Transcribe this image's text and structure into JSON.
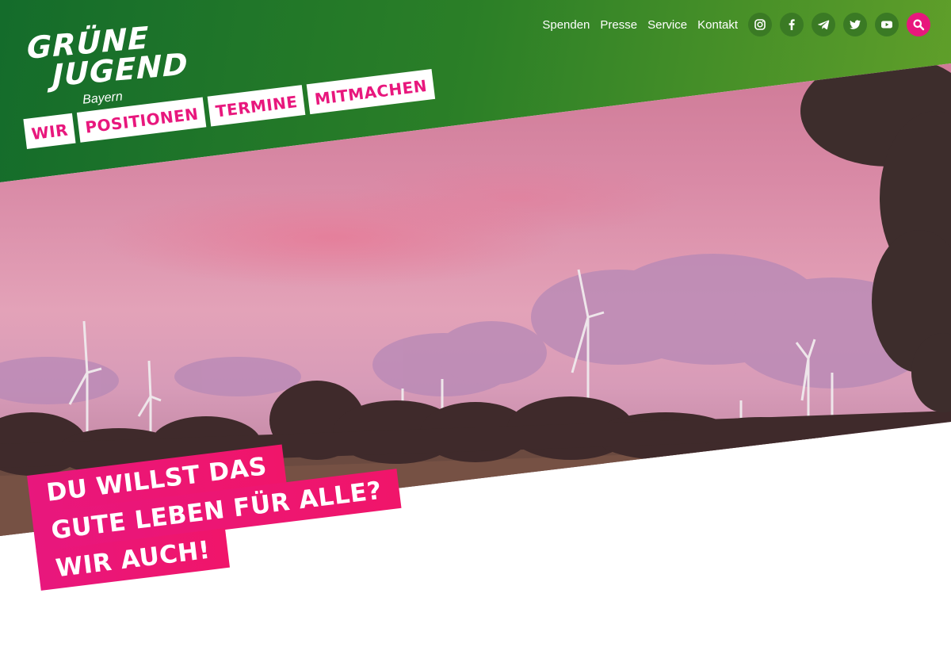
{
  "logo": {
    "line1": "GRÜNE",
    "line2": "JUGEND",
    "sub": "Bayern"
  },
  "top_nav": {
    "links": [
      "Spenden",
      "Presse",
      "Service",
      "Kontakt"
    ],
    "icons": [
      "instagram-icon",
      "facebook-icon",
      "telegram-icon",
      "twitter-icon",
      "youtube-icon",
      "search-icon"
    ]
  },
  "main_nav": {
    "items": [
      "WIR",
      "POSITIONEN",
      "TERMINE",
      "MITMACHEN"
    ]
  },
  "hero": {
    "headline_lines": [
      "DU WILLST DAS",
      "GUTE LEBEN FÜR ALLE?",
      "WIR AUCH!"
    ]
  },
  "colors": {
    "brand_green_dark": "#146c2b",
    "brand_green_light": "#6aa52a",
    "brand_magenta": "#e8177d"
  }
}
